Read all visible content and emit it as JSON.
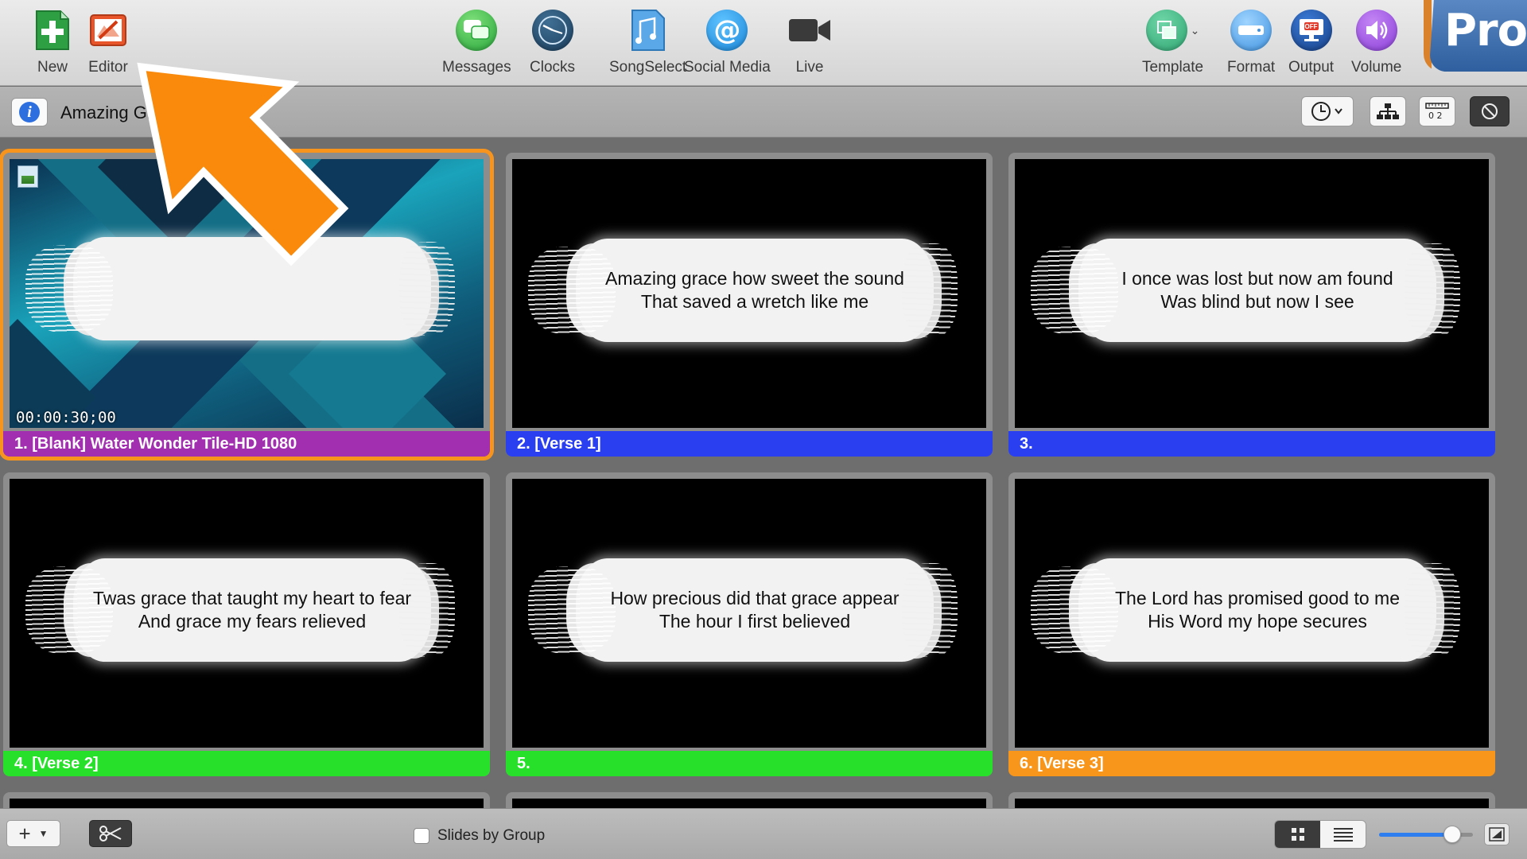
{
  "toolbar": {
    "new_label": "New",
    "editor_label": "Editor",
    "messages_label": "Messages",
    "clocks_label": "Clocks",
    "songselect_label": "SongSelect",
    "social_label": "Social Media",
    "live_label": "Live",
    "template_label": "Template",
    "format_label": "Format",
    "output_label": "Output",
    "volume_label": "Volume",
    "pro_badge": "Pro",
    "output_badge": "OFF"
  },
  "infobar": {
    "doc_title": "Amazing Grace"
  },
  "slides": [
    {
      "label": "1. [Blank] Water Wonder Tile-HD 1080",
      "timecode": "00:00:30;00",
      "line1": "",
      "line2": "",
      "color": "#a12fb0"
    },
    {
      "label": "2. [Verse 1]",
      "line1": "Amazing grace how sweet the sound",
      "line2": "That saved a wretch like me",
      "color": "#2a3ff0"
    },
    {
      "label": "3.",
      "line1": "I once was lost but now am found",
      "line2": "Was blind but now I see",
      "color": "#2a3ff0"
    },
    {
      "label": "4. [Verse 2]",
      "line1": "Twas grace that taught my heart to fear",
      "line2": "And grace my fears relieved",
      "color": "#27e02a"
    },
    {
      "label": "5.",
      "line1": "How precious did that grace appear",
      "line2": "The hour I first believed",
      "color": "#27e02a"
    },
    {
      "label": "6. [Verse 3]",
      "line1": "The Lord has promised good to me",
      "line2": "His Word my hope secures",
      "color": "#f7961b"
    }
  ],
  "bottombar": {
    "slides_by_group_label": "Slides by Group",
    "slides_by_group_checked": false,
    "zoom_level": 0.78
  },
  "colors": {
    "selection_outline": "#f7941d",
    "annotation_arrow": "#f98a0c",
    "accent_blue": "#2f7ef0"
  },
  "icons": {
    "new": "plus-icon",
    "editor": "editor-icon",
    "messages": "messages-icon",
    "clocks": "clock-icon",
    "songselect": "songselect-icon",
    "social": "at-icon",
    "live": "video-camera-icon",
    "template": "template-icon",
    "format": "format-icon",
    "output": "monitor-icon",
    "volume": "speaker-icon"
  }
}
